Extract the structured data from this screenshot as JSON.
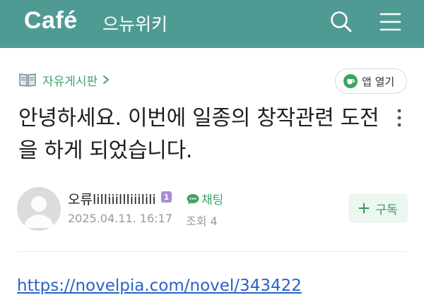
{
  "header": {
    "logo_text": "Café",
    "cafe_name": "으뉴위키",
    "bg_color": "#4f9b94",
    "search_icon": "search-icon",
    "menu_icon": "hamburger-menu-icon"
  },
  "board": {
    "icon": "book-icon",
    "name": "자유게시판",
    "chevron": "chevron-right-icon"
  },
  "app_button": {
    "icon": "cafe-cup-icon",
    "label": "앱 열기"
  },
  "post": {
    "title": "안녕하세요. 이번에 일종의 창작관련 도전을 하게 되었습니다.",
    "author": "오류lilliiillliiilili",
    "level_badge": "1",
    "chat_label": "채팅",
    "date": "2025.04.11. 16:17",
    "views": "조회 4",
    "body_link": "https://novelpia.com/novel/343422"
  },
  "subscribe": {
    "label": "구독",
    "icon": "plus-icon"
  },
  "colors": {
    "accent_green": "#41a36b",
    "link_blue": "#2a62c8",
    "badge_purple": "#a98cd7"
  }
}
